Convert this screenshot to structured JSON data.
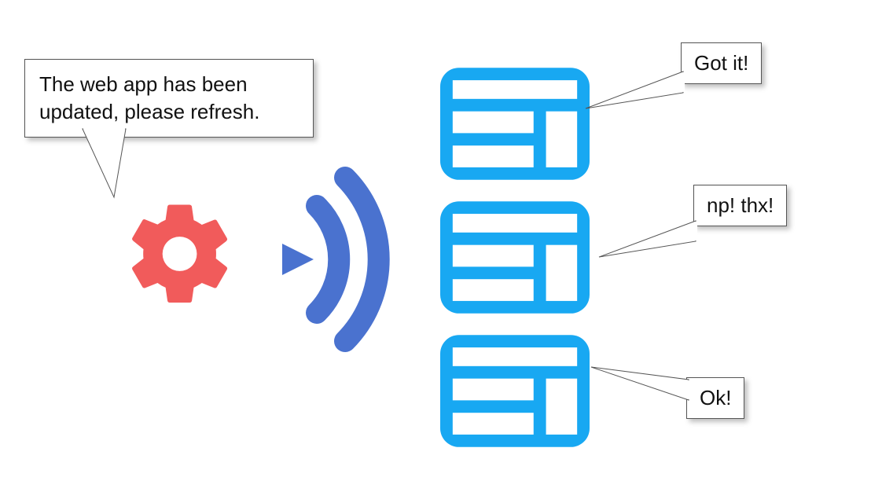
{
  "server_message": "The web app has been updated, please refresh.",
  "tab_responses": {
    "tab1": "Got it!",
    "tab2": "np! thx!",
    "tab3": "Ok!"
  },
  "colors": {
    "gear": "#F15B5B",
    "signal": "#4A72CF",
    "tab": "#18A8F2"
  }
}
